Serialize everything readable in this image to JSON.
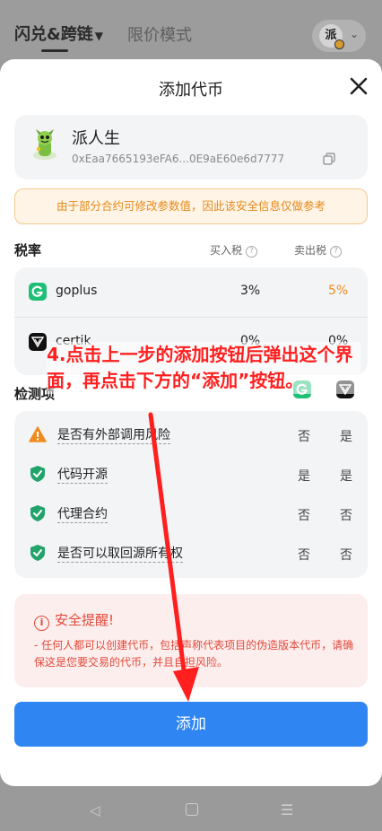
{
  "background": {
    "tab_swap_bridge": "闪兑&跨链",
    "tab_swap_caret": "▼",
    "tab_limit": "限价模式",
    "avatar_char": "派"
  },
  "modal": {
    "title": "添加代币",
    "token": {
      "name": "派人生",
      "address": "0xEaa7665193eFA6...0E9aE60e6d7777"
    },
    "notice": "由于部分合约可修改参数值，因此该安全信息仅做参考",
    "tax": {
      "label": "税率",
      "buy_header": "买入税",
      "sell_header": "卖出税",
      "rows": [
        {
          "provider": "goplus",
          "buy": "3%",
          "sell": "5%"
        },
        {
          "provider": "certik",
          "buy": "0%",
          "sell": "0%"
        }
      ]
    },
    "detection": {
      "label": "检测项",
      "items": [
        {
          "label": "是否有外部调用风险",
          "status": "warning",
          "a": "否",
          "b": "是"
        },
        {
          "label": "代码开源",
          "status": "safe",
          "a": "是",
          "b": "是"
        },
        {
          "label": "代理合约",
          "status": "safe",
          "a": "否",
          "b": "否"
        },
        {
          "label": "是否可以取回源所有权",
          "status": "safe",
          "a": "否",
          "b": "否"
        }
      ]
    },
    "warning": {
      "title": "安全提醒!",
      "body": "- 任何人都可以创建代币，包括声称代表项目的伪造版本代币，请确保这是您要交易的代币，并且自担风险。"
    },
    "add_button": "添加"
  },
  "annotation": {
    "text": "4.点击上一步的添加按钮后弹出这个界面，再点击下方的“添加”按钮。"
  },
  "colors": {
    "primary": "#2f86f3",
    "danger": "#e04a3a",
    "warning_orange": "#f08b1f",
    "safe_green": "#22a36a",
    "annotation_red": "#ff1f1f"
  }
}
